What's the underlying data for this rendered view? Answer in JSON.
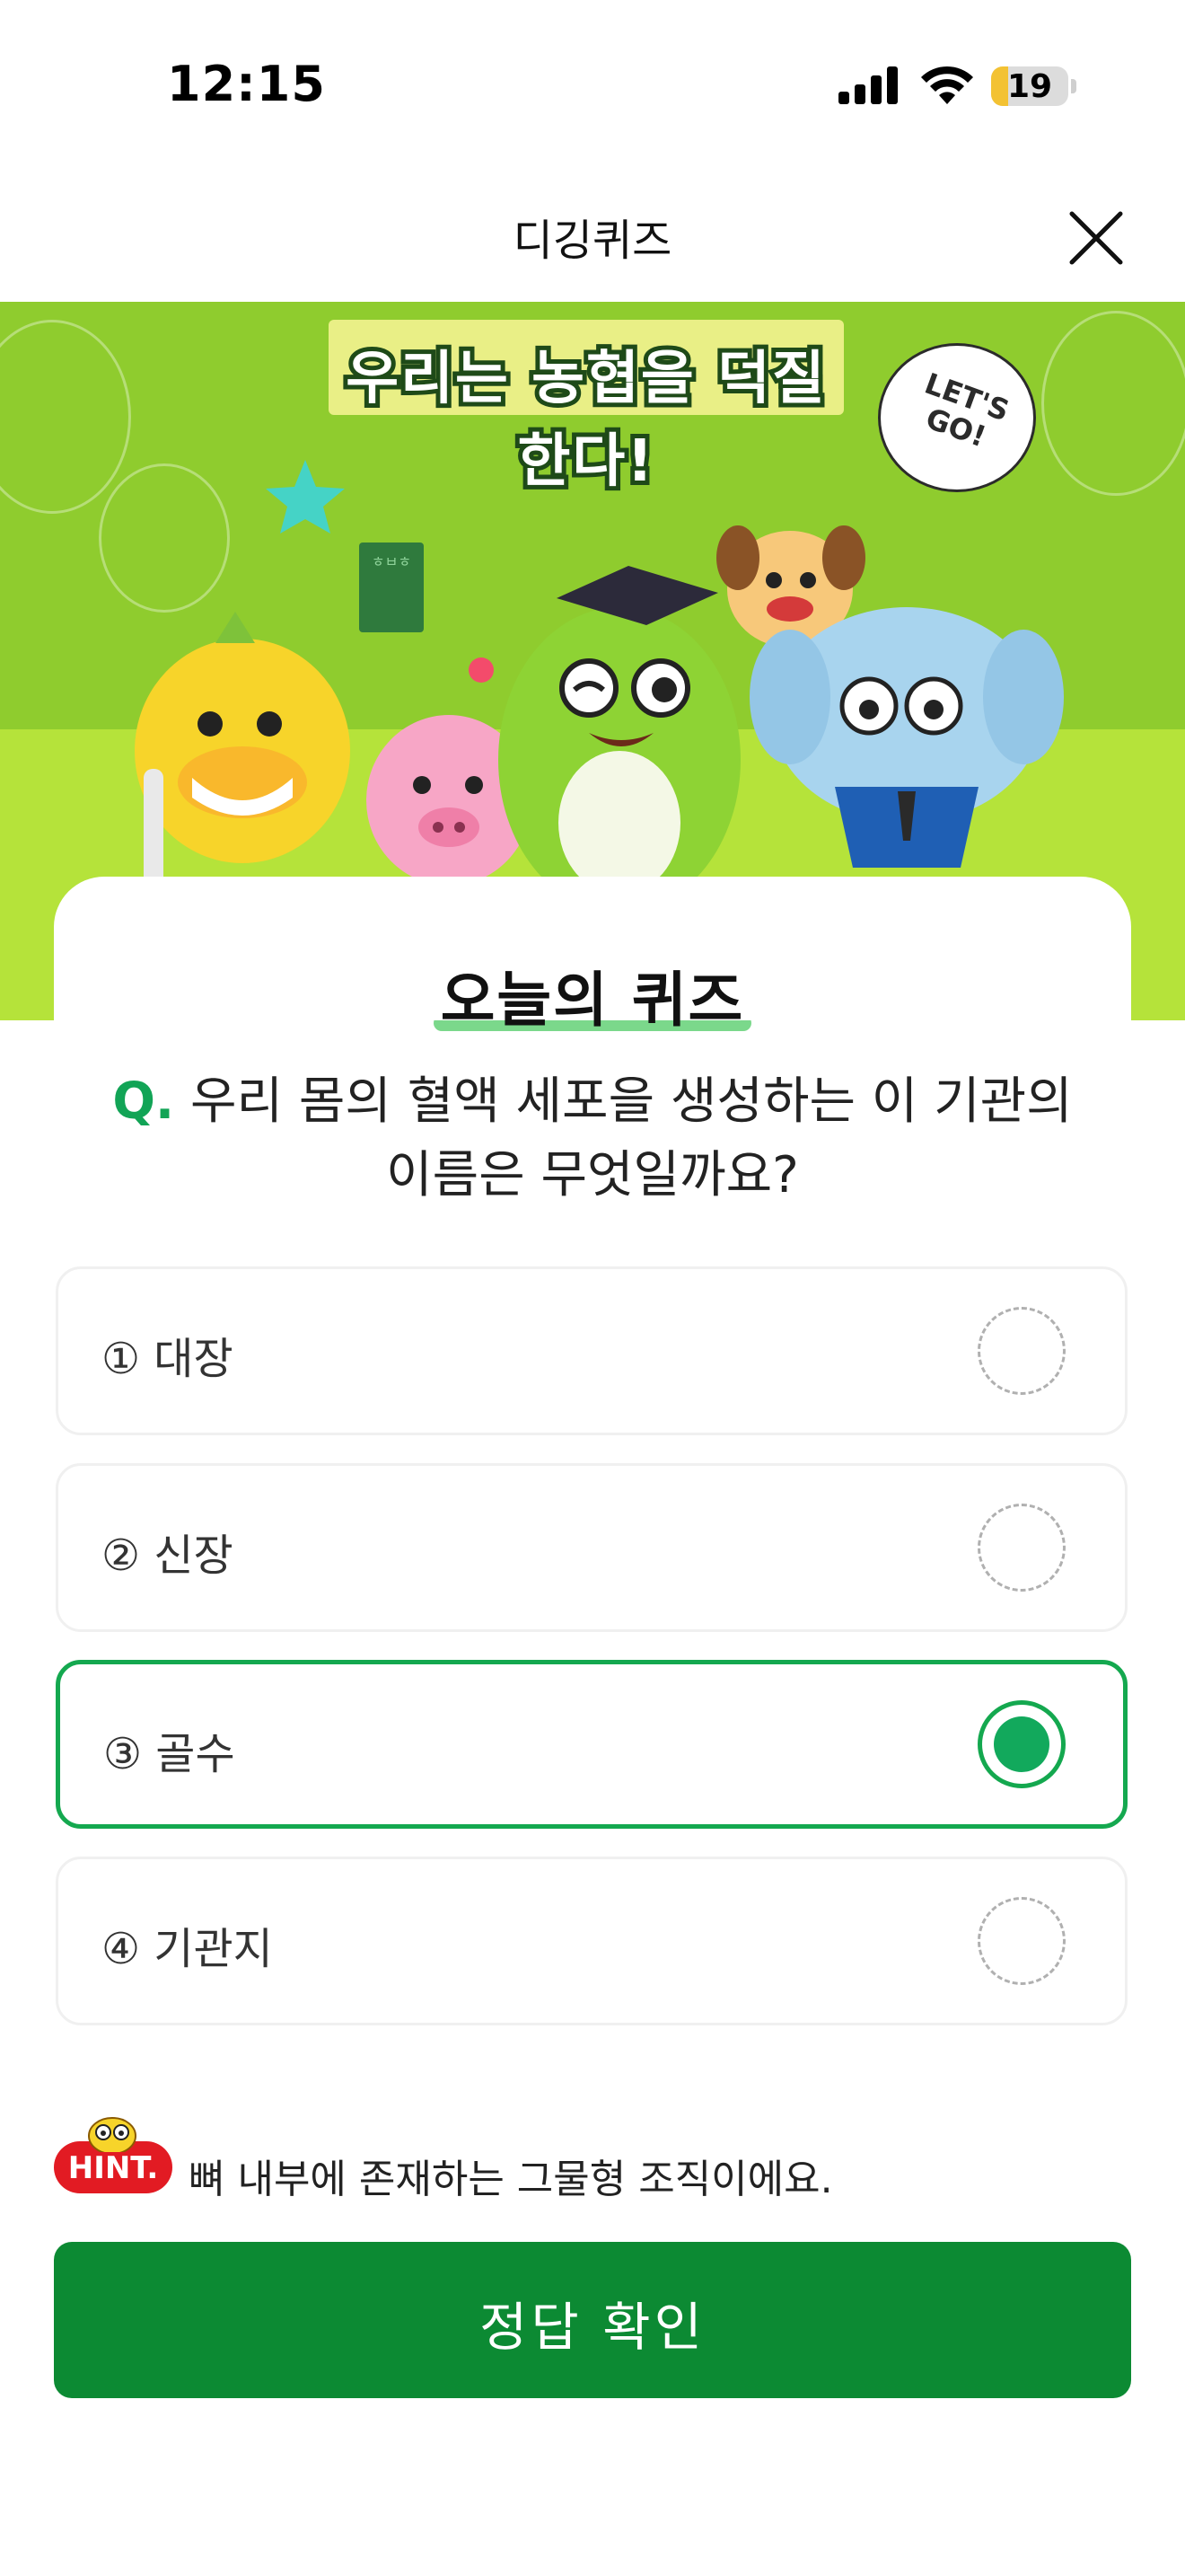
{
  "status_bar": {
    "time": "12:15",
    "battery": "19"
  },
  "header": {
    "title": "디깅퀴즈",
    "close_icon": "close-icon"
  },
  "banner": {
    "tagline": "우리는 농협을 덕질한다!",
    "bubble": "LET'S GO!",
    "book_label": "ㅎㅂㅎ"
  },
  "quiz": {
    "heading": "오늘의 퀴즈",
    "question_mark": "Q.",
    "question": "우리 몸의 혈액 세포을 생성하는 이 기관의 이름은 무엇일까요?",
    "options": [
      {
        "label": "① 대장",
        "selected": false
      },
      {
        "label": "② 신장",
        "selected": false
      },
      {
        "label": "③ 골수",
        "selected": true
      },
      {
        "label": "④ 기관지",
        "selected": false
      }
    ]
  },
  "hint": {
    "badge": "HINT.",
    "text": "뼈 내부에 존재하는 그물형 조직이에요."
  },
  "confirm_button": {
    "label": "정답 확인"
  },
  "colors": {
    "accent": "#0c8a33",
    "selected": "#14a84f",
    "hint_badge": "#e21b23",
    "banner": "#8fcc2e"
  }
}
